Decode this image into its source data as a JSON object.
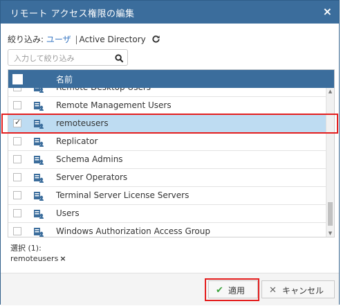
{
  "dialog": {
    "title": "リモート アクセス権限の編集",
    "close_glyph": "×"
  },
  "filter": {
    "prefix": "絞り込み:",
    "option_users": "ユーザ",
    "separator": "|",
    "option_ad": "Active Directory"
  },
  "search": {
    "placeholder": "入力して絞り込み",
    "value": ""
  },
  "grid": {
    "header_label": "名前",
    "rows": [
      {
        "name": "Remote Desktop Users",
        "checked": false,
        "selected": false
      },
      {
        "name": "Remote Management Users",
        "checked": false,
        "selected": false
      },
      {
        "name": "remoteusers",
        "checked": true,
        "selected": true
      },
      {
        "name": "Replicator",
        "checked": false,
        "selected": false
      },
      {
        "name": "Schema Admins",
        "checked": false,
        "selected": false
      },
      {
        "name": "Server Operators",
        "checked": false,
        "selected": false
      },
      {
        "name": "Terminal Server License Servers",
        "checked": false,
        "selected": false
      },
      {
        "name": "Users",
        "checked": false,
        "selected": false
      },
      {
        "name": "Windows Authorization Access Group",
        "checked": false,
        "selected": false
      }
    ],
    "row_icon": "group-icon"
  },
  "selection": {
    "label": "選択 (1):",
    "chips": [
      "remoteusers"
    ]
  },
  "footer": {
    "apply_label": "適用",
    "cancel_label": "キャンセル"
  },
  "colors": {
    "titlebar": "#3b6d9c",
    "selected_row": "#bedcf2",
    "highlight_box": "#e41d1d",
    "link": "#3a78c3",
    "apply_check": "#3aa23a"
  }
}
